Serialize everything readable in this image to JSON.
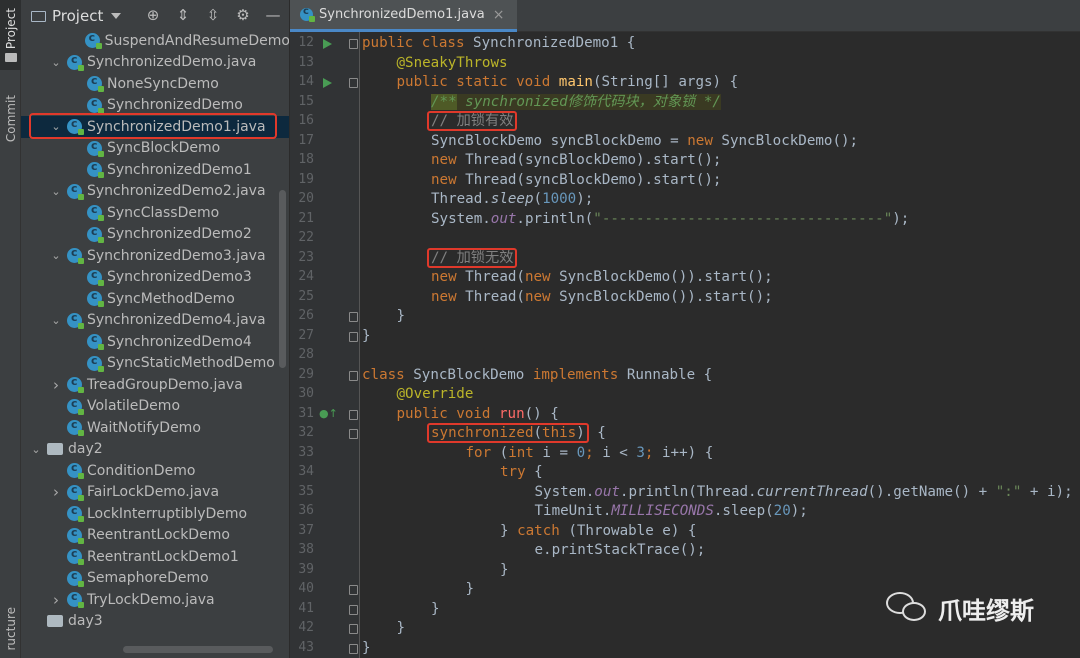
{
  "toolstrip": {
    "project_label": "Project",
    "commit_label": "Commit",
    "structure_label": "ructure"
  },
  "project_panel": {
    "title": "Project",
    "tree": [
      {
        "label": "SuspendAndResumeDemo",
        "kind": "class",
        "indent": 2,
        "chevron": ""
      },
      {
        "label": "SynchronizedDemo.java",
        "kind": "class",
        "indent": 1,
        "chevron": "down"
      },
      {
        "label": "NoneSyncDemo",
        "kind": "class",
        "indent": 2,
        "chevron": ""
      },
      {
        "label": "SynchronizedDemo",
        "kind": "class",
        "indent": 2,
        "chevron": ""
      },
      {
        "label": "SynchronizedDemo1.java",
        "kind": "class",
        "indent": 1,
        "chevron": "down",
        "selected": true
      },
      {
        "label": "SyncBlockDemo",
        "kind": "class",
        "indent": 2,
        "chevron": ""
      },
      {
        "label": "SynchronizedDemo1",
        "kind": "class",
        "indent": 2,
        "chevron": ""
      },
      {
        "label": "SynchronizedDemo2.java",
        "kind": "class",
        "indent": 1,
        "chevron": "down"
      },
      {
        "label": "SyncClassDemo",
        "kind": "class",
        "indent": 2,
        "chevron": ""
      },
      {
        "label": "SynchronizedDemo2",
        "kind": "class",
        "indent": 2,
        "chevron": ""
      },
      {
        "label": "SynchronizedDemo3.java",
        "kind": "class",
        "indent": 1,
        "chevron": "down"
      },
      {
        "label": "SynchronizedDemo3",
        "kind": "class",
        "indent": 2,
        "chevron": ""
      },
      {
        "label": "SyncMethodDemo",
        "kind": "class",
        "indent": 2,
        "chevron": ""
      },
      {
        "label": "SynchronizedDemo4.java",
        "kind": "class",
        "indent": 1,
        "chevron": "down"
      },
      {
        "label": "SynchronizedDemo4",
        "kind": "class",
        "indent": 2,
        "chevron": ""
      },
      {
        "label": "SyncStaticMethodDemo",
        "kind": "class",
        "indent": 2,
        "chevron": ""
      },
      {
        "label": "TreadGroupDemo.java",
        "kind": "class",
        "indent": 1,
        "chevron": "right"
      },
      {
        "label": "VolatileDemo",
        "kind": "class",
        "indent": 1,
        "chevron": ""
      },
      {
        "label": "WaitNotifyDemo",
        "kind": "class",
        "indent": 1,
        "chevron": ""
      },
      {
        "label": "day2",
        "kind": "dir",
        "indent": 0,
        "chevron": "down"
      },
      {
        "label": "ConditionDemo",
        "kind": "class",
        "indent": 1,
        "chevron": ""
      },
      {
        "label": "FairLockDemo.java",
        "kind": "class",
        "indent": 1,
        "chevron": "right"
      },
      {
        "label": "LockInterruptiblyDemo",
        "kind": "class",
        "indent": 1,
        "chevron": ""
      },
      {
        "label": "ReentrantLockDemo",
        "kind": "class",
        "indent": 1,
        "chevron": ""
      },
      {
        "label": "ReentrantLockDemo1",
        "kind": "class",
        "indent": 1,
        "chevron": ""
      },
      {
        "label": "SemaphoreDemo",
        "kind": "class",
        "indent": 1,
        "chevron": ""
      },
      {
        "label": "TryLockDemo.java",
        "kind": "class",
        "indent": 1,
        "chevron": "right"
      },
      {
        "label": "day3",
        "kind": "dir",
        "indent": 0,
        "chevron": ""
      }
    ]
  },
  "editor": {
    "tab_label": "SynchronizedDemo1.java",
    "line_numbers": [
      "12",
      "13",
      "14",
      "15",
      "16",
      "17",
      "18",
      "19",
      "20",
      "21",
      "22",
      "23",
      "24",
      "25",
      "26",
      "27",
      "28",
      "29",
      "30",
      "31",
      "32",
      "33",
      "34",
      "35",
      "36",
      "37",
      "38",
      "39",
      "40",
      "41",
      "42",
      "43"
    ],
    "lines": [
      {
        "indent": 0,
        "tokens": [
          [
            "k",
            "public "
          ],
          [
            "k",
            "class "
          ],
          [
            "t",
            "SynchronizedDemo1 {"
          ]
        ]
      },
      {
        "indent": 1,
        "tokens": [
          [
            "a",
            "@SneakyThrows"
          ]
        ]
      },
      {
        "indent": 1,
        "tokens": [
          [
            "k",
            "public static void "
          ],
          [
            "f",
            "main"
          ],
          [
            "t",
            "(String[] args) {"
          ]
        ]
      },
      {
        "indent": 2,
        "tokens": [
          [
            "doc-kw",
            "/**"
          ],
          [
            "doc",
            " synchronized修饰代码块，对象锁 */"
          ]
        ]
      },
      {
        "indent": 2,
        "box": true,
        "tokens": [
          [
            "c",
            "// 加锁有效"
          ]
        ]
      },
      {
        "indent": 2,
        "tokens": [
          [
            "t",
            "SyncBlockDemo syncBlockDemo = "
          ],
          [
            "k",
            "new "
          ],
          [
            "t",
            "SyncBlockDemo();"
          ]
        ]
      },
      {
        "indent": 2,
        "tokens": [
          [
            "k",
            "new "
          ],
          [
            "t",
            "Thread(syncBlockDemo).start();"
          ]
        ]
      },
      {
        "indent": 2,
        "tokens": [
          [
            "k",
            "new "
          ],
          [
            "t",
            "Thread(syncBlockDemo).start();"
          ]
        ]
      },
      {
        "indent": 2,
        "tokens": [
          [
            "t",
            "Thread."
          ],
          [
            "sm",
            "sleep"
          ],
          [
            "t",
            "("
          ],
          [
            "n",
            "1000"
          ],
          [
            "t",
            ");"
          ]
        ]
      },
      {
        "indent": 2,
        "tokens": [
          [
            "t",
            "System."
          ],
          [
            "st",
            "out"
          ],
          [
            "t",
            ".println("
          ],
          [
            "s",
            "\"---------------------------------\""
          ],
          [
            "t",
            ");"
          ]
        ]
      },
      {
        "indent": 0,
        "tokens": []
      },
      {
        "indent": 2,
        "box": true,
        "tokens": [
          [
            "c",
            "// 加锁无效"
          ]
        ]
      },
      {
        "indent": 2,
        "tokens": [
          [
            "k",
            "new "
          ],
          [
            "t",
            "Thread("
          ],
          [
            "k",
            "new "
          ],
          [
            "t",
            "SyncBlockDemo()).start();"
          ]
        ]
      },
      {
        "indent": 2,
        "tokens": [
          [
            "k",
            "new "
          ],
          [
            "t",
            "Thread("
          ],
          [
            "k",
            "new "
          ],
          [
            "t",
            "SyncBlockDemo()).start();"
          ]
        ]
      },
      {
        "indent": 1,
        "tokens": [
          [
            "t",
            "}"
          ]
        ]
      },
      {
        "indent": 0,
        "tokens": [
          [
            "t",
            "}"
          ]
        ]
      },
      {
        "indent": 0,
        "tokens": []
      },
      {
        "indent": 0,
        "tokens": [
          [
            "k",
            "class "
          ],
          [
            "t",
            "SyncBlockDemo "
          ],
          [
            "k",
            "implements "
          ],
          [
            "t",
            "Runnable {"
          ]
        ]
      },
      {
        "indent": 1,
        "tokens": [
          [
            "a",
            "@Override"
          ]
        ]
      },
      {
        "indent": 1,
        "tokens": [
          [
            "k",
            "public void "
          ],
          [
            "fn",
            "run"
          ],
          [
            "t",
            "() {"
          ]
        ]
      },
      {
        "indent": 2,
        "box": true,
        "tokens": [
          [
            "k",
            "synchronized"
          ],
          [
            "t",
            "("
          ],
          [
            "k",
            "this"
          ],
          [
            "t",
            ")"
          ]
        ],
        "after": [
          [
            "t",
            " {"
          ]
        ]
      },
      {
        "indent": 3,
        "tokens": [
          [
            "k",
            "for "
          ],
          [
            "t",
            "("
          ],
          [
            "k",
            "int "
          ],
          [
            "t",
            "i = "
          ],
          [
            "n",
            "0"
          ],
          [
            "k",
            "; "
          ],
          [
            "t",
            "i < "
          ],
          [
            "n",
            "3"
          ],
          [
            "k",
            "; "
          ],
          [
            "t",
            "i++) {"
          ]
        ]
      },
      {
        "indent": 4,
        "tokens": [
          [
            "k",
            "try "
          ],
          [
            "t",
            "{"
          ]
        ]
      },
      {
        "indent": 5,
        "tokens": [
          [
            "t",
            "System."
          ],
          [
            "st",
            "out"
          ],
          [
            "t",
            ".println(Thread."
          ],
          [
            "sm",
            "currentThread"
          ],
          [
            "t",
            "().getName() + "
          ],
          [
            "s",
            "\":\""
          ],
          [
            "t",
            " + i);"
          ]
        ]
      },
      {
        "indent": 5,
        "tokens": [
          [
            "t",
            "TimeUnit."
          ],
          [
            "st",
            "MILLISECONDS"
          ],
          [
            "t",
            ".sleep("
          ],
          [
            "n",
            "20"
          ],
          [
            "t",
            ");"
          ]
        ]
      },
      {
        "indent": 4,
        "tokens": [
          [
            "t",
            "} "
          ],
          [
            "k",
            "catch "
          ],
          [
            "t",
            "(Throwable e) {"
          ]
        ]
      },
      {
        "indent": 5,
        "tokens": [
          [
            "t",
            "e.printStackTrace();"
          ]
        ]
      },
      {
        "indent": 4,
        "tokens": [
          [
            "t",
            "}"
          ]
        ]
      },
      {
        "indent": 3,
        "tokens": [
          [
            "t",
            "}"
          ]
        ]
      },
      {
        "indent": 2,
        "tokens": [
          [
            "t",
            "}"
          ]
        ]
      },
      {
        "indent": 1,
        "tokens": [
          [
            "t",
            "}"
          ]
        ]
      },
      {
        "indent": 0,
        "tokens": [
          [
            "t",
            "}"
          ]
        ]
      }
    ]
  },
  "watermark": {
    "text": "爪哇缪斯"
  },
  "colors": {
    "keyword": "#cc7832",
    "annotation": "#bbb529",
    "method": "#ffc66d",
    "number": "#6897bb",
    "string": "#6a8759",
    "comment": "#808080",
    "highlight_box": "#e0392b"
  }
}
